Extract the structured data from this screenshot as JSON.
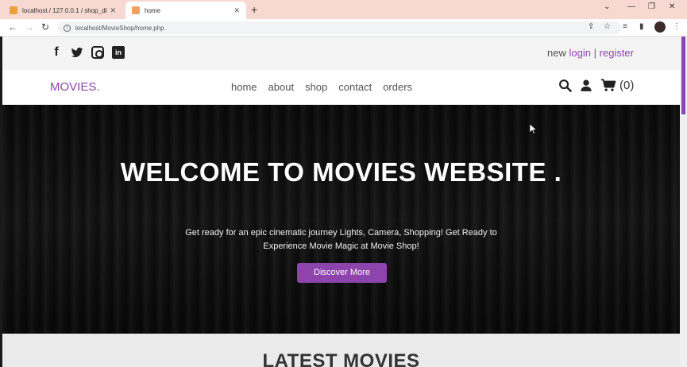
{
  "browser": {
    "tabs": [
      {
        "title": "localhost / 127.0.0.1 / shop_db |",
        "active": false
      },
      {
        "title": "home",
        "active": true
      }
    ],
    "address": "localhost/MovieShop/home.php"
  },
  "topbar": {
    "social": [
      "facebook-icon",
      "twitter-icon",
      "instagram-icon",
      "linkedin-icon"
    ],
    "auth_prefix": "new",
    "login": "login",
    "separator": "|",
    "register": "register"
  },
  "header": {
    "logo": "MOVIES.",
    "nav": [
      "home",
      "about",
      "shop",
      "contact",
      "orders"
    ],
    "cart_count": "(0)"
  },
  "hero": {
    "title": "WELCOME TO MOVIES WEBSITE .",
    "subtitle": "Get ready for an epic cinematic journey Lights, Camera, Shopping! Get Ready to Experience Movie Magic at Movie Shop!",
    "button": "Discover More"
  },
  "section": {
    "title": "LATEST MOVIES"
  },
  "colors": {
    "accent": "#8e44ad",
    "tabbar": "#f7d9d2"
  }
}
